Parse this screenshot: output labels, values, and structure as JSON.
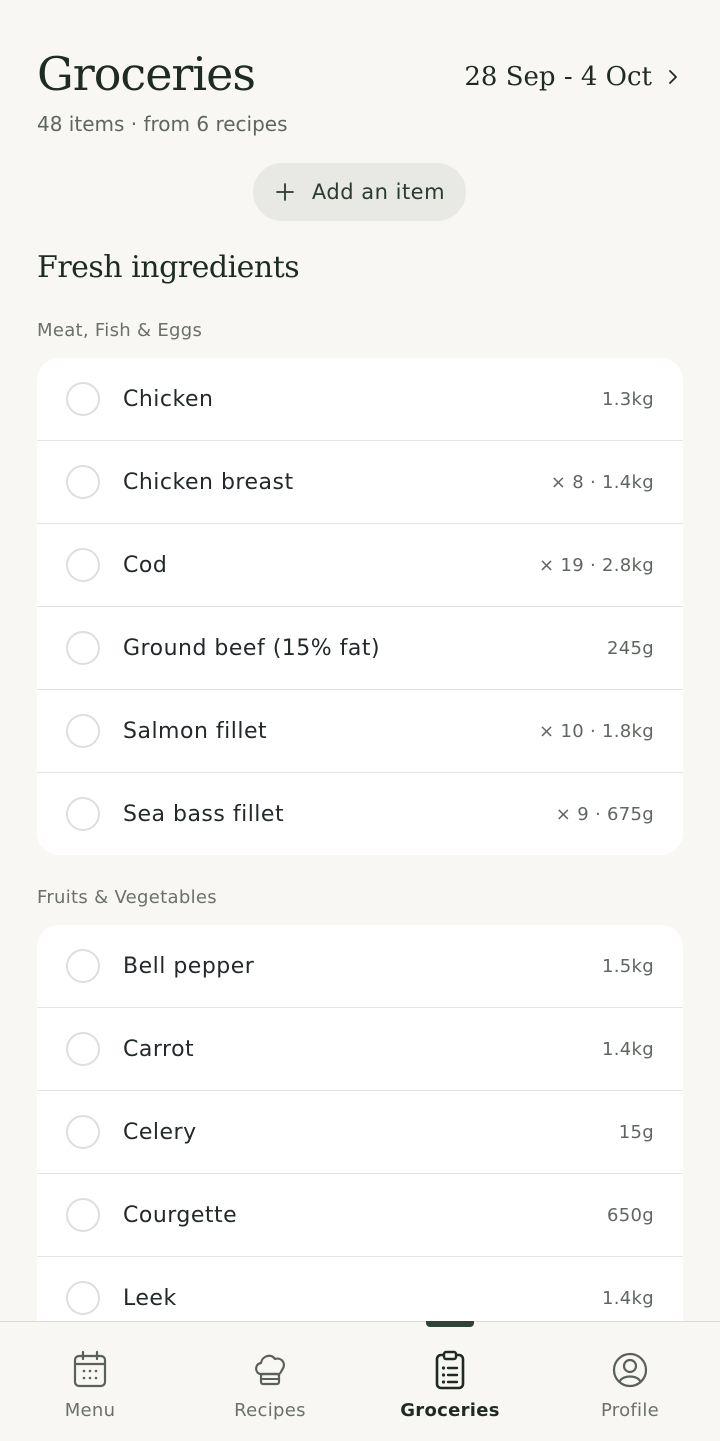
{
  "header": {
    "title": "Groceries",
    "date_range": "28 Sep - 4 Oct",
    "subtitle": "48 items · from 6 recipes"
  },
  "add_button": {
    "label": "Add an item"
  },
  "section_title": "Fresh ingredients",
  "groups": [
    {
      "title": "Meat, Fish & Eggs",
      "items": [
        {
          "name": "Chicken",
          "qty": "1.3kg"
        },
        {
          "name": "Chicken breast",
          "qty": "× 8 · 1.4kg"
        },
        {
          "name": "Cod",
          "qty": "× 19 · 2.8kg"
        },
        {
          "name": "Ground beef (15% fat)",
          "qty": "245g"
        },
        {
          "name": "Salmon fillet",
          "qty": "× 10 · 1.8kg"
        },
        {
          "name": "Sea bass fillet",
          "qty": "× 9 · 675g"
        }
      ]
    },
    {
      "title": "Fruits & Vegetables",
      "items": [
        {
          "name": "Bell pepper",
          "qty": "1.5kg"
        },
        {
          "name": "Carrot",
          "qty": "1.4kg"
        },
        {
          "name": "Celery",
          "qty": "15g"
        },
        {
          "name": "Courgette",
          "qty": "650g"
        },
        {
          "name": "Leek",
          "qty": "1.4kg"
        }
      ]
    }
  ],
  "nav": {
    "items": [
      {
        "label": "Menu",
        "icon": "calendar-icon"
      },
      {
        "label": "Recipes",
        "icon": "chef-hat-icon"
      },
      {
        "label": "Groceries",
        "icon": "clipboard-list-icon"
      },
      {
        "label": "Profile",
        "icon": "user-circle-icon"
      }
    ],
    "active": "Groceries"
  },
  "colors": {
    "background": "#f8f7f3",
    "card": "#ffffff",
    "accent": "#2f4438",
    "add_button_bg": "#e8e9e4"
  }
}
